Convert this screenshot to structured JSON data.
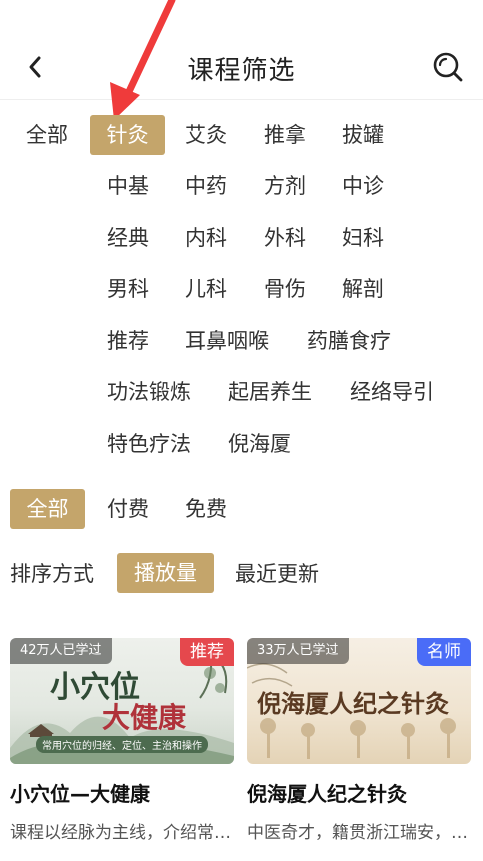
{
  "header": {
    "title": "课程筛选",
    "back_icon": "chevron-left-icon",
    "search_icon": "search-icon"
  },
  "category": {
    "items": [
      "全部",
      "针灸",
      "艾灸",
      "推拿",
      "拔罐",
      "中基",
      "中药",
      "方剂",
      "中诊",
      "经典",
      "内科",
      "外科",
      "妇科",
      "男科",
      "儿科",
      "骨伤",
      "解剖",
      "推荐",
      "耳鼻咽喉",
      "药膳食疗",
      "功法锻炼",
      "起居养生",
      "经络导引",
      "特色疗法",
      "倪海厦"
    ],
    "selected": "针灸"
  },
  "price": {
    "items": [
      "全部",
      "付费",
      "免费"
    ],
    "selected": "全部"
  },
  "sort": {
    "label": "排序方式",
    "items": [
      "播放量",
      "最近更新"
    ],
    "selected": "播放量"
  },
  "colors": {
    "accent": "#c4a56b",
    "badge_recommend": "#e5484d",
    "badge_teacher": "#4a6cf7"
  },
  "courses": [
    {
      "learned": "42万人已学过",
      "badge": "推荐",
      "badge_color": "#e5484d",
      "cover_title_1": "小穴位",
      "cover_title_2": "大健康",
      "cover_subtitle": "常用穴位的归经、定位、主治和操作",
      "title": "小穴位—大健康",
      "desc": "课程以经脉为主线，介绍常用穴位的归经、定位、主治和操作"
    },
    {
      "learned": "33万人已学过",
      "badge": "名师",
      "badge_color": "#4a6cf7",
      "cover_title_1": "倪海厦人纪之针灸",
      "title": "倪海厦人纪之针灸",
      "desc": "中医奇才，籍贯浙江瑞安，台湾中医名家"
    }
  ]
}
